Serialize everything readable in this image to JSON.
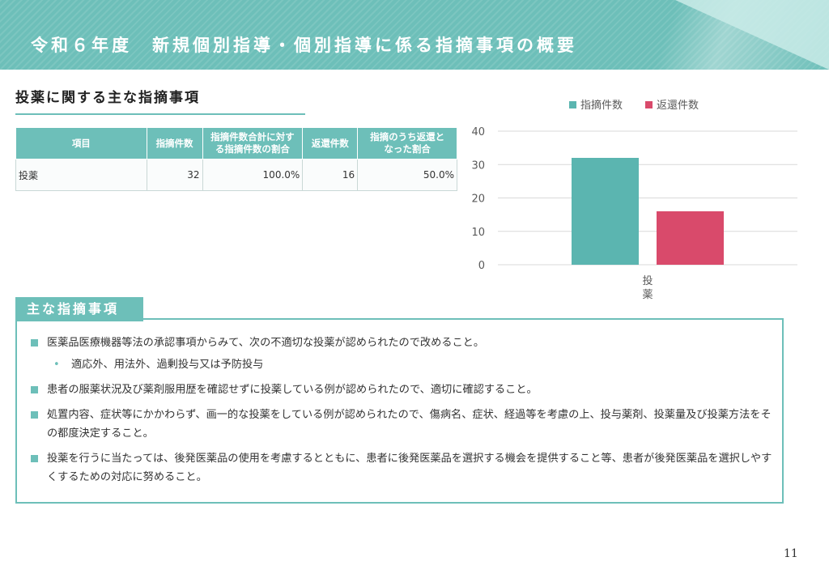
{
  "header": {
    "title": "令和６年度　新規個別指導・個別指導に係る指摘事項の概要"
  },
  "section1": {
    "title": "投薬に関する主な指摘事項"
  },
  "table": {
    "headers": [
      "項目",
      "指摘件数",
      "指摘件数合計に対する指摘件数の割合",
      "返還件数",
      "指摘のうち返還となった割合"
    ],
    "header_lines": [
      [
        "項目"
      ],
      [
        "指摘件数"
      ],
      [
        "指摘件数合計に対す",
        "る指摘件数の割合"
      ],
      [
        "返還件数"
      ],
      [
        "指摘のうち返還と",
        "なった割合"
      ]
    ],
    "rows": [
      {
        "item": "投薬",
        "count": "32",
        "ratio": "100.0%",
        "returned": "16",
        "returned_ratio": "50.0%"
      }
    ]
  },
  "chart_data": {
    "type": "bar",
    "categories": [
      "投薬"
    ],
    "category_label_chars": [
      "投",
      "薬"
    ],
    "series": [
      {
        "name": "指摘件数",
        "values": [
          32
        ],
        "color": "#5bb5b0"
      },
      {
        "name": "返還件数",
        "values": [
          16
        ],
        "color": "#d94a6b"
      }
    ],
    "ylim": [
      0,
      40
    ],
    "yticks": [
      "0",
      "10",
      "20",
      "30",
      "40"
    ],
    "legend": "top-center",
    "grid": true
  },
  "section2": {
    "title": "主な指摘事項",
    "items": [
      {
        "level": "main",
        "text": "医薬品医療機器等法の承認事項からみて、次の不適切な投薬が認められたので改めること。"
      },
      {
        "level": "sub",
        "text": "適応外、用法外、過剰投与又は予防投与"
      },
      {
        "level": "main",
        "text": "患者の服薬状況及び薬剤服用歴を確認せずに投薬している例が認められたので、適切に確認すること。"
      },
      {
        "level": "main",
        "text": "処置内容、症状等にかかわらず、画一的な投薬をしている例が認められたので、傷病名、症状、経過等を考慮の上、投与薬剤、投薬量及び投薬方法をその都度決定すること。"
      },
      {
        "level": "main",
        "text": "投薬を行うに当たっては、後発医薬品の使用を考慮するとともに、患者に後発医薬品を選択する機会を提供すること等、患者が後発医薬品を選択しやすくするための対応に努めること。"
      }
    ]
  },
  "page_number": "11"
}
